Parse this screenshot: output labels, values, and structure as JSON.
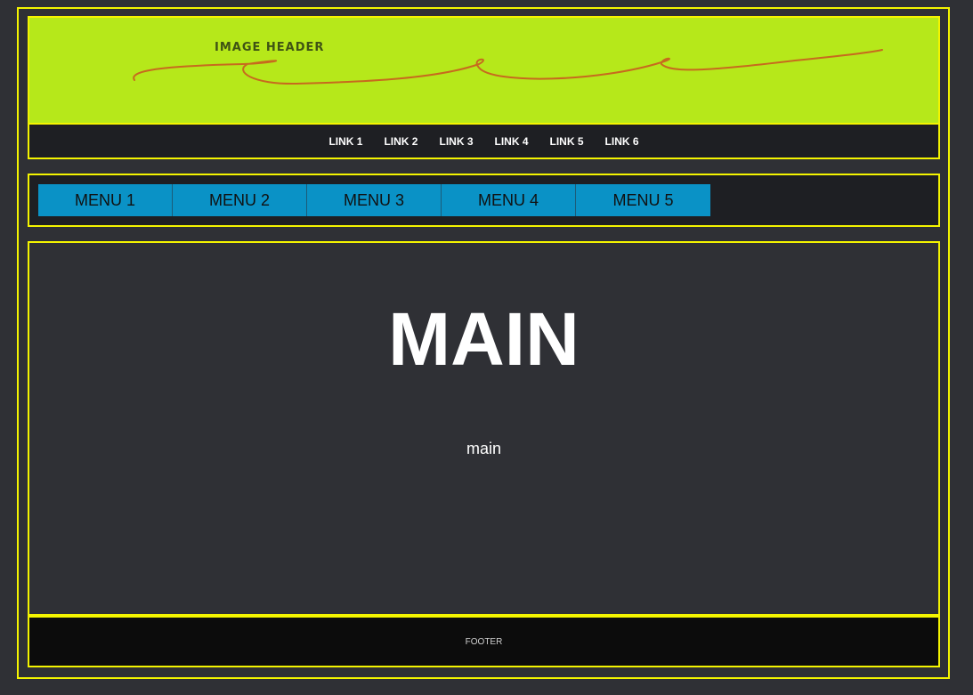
{
  "colors": {
    "background": "#2f3035",
    "border": "#f4f400",
    "header_image": "#b6e81a",
    "nav_background": "#1e1f23",
    "menu_item": "#0a92c6",
    "footer_background": "#0c0c0c"
  },
  "header": {
    "image_label": "IMAGE HEADER"
  },
  "top_nav": {
    "links": [
      "LINK 1",
      "LINK 2",
      "LINK 3",
      "LINK 4",
      "LINK 5",
      "LINK 6"
    ]
  },
  "menu": {
    "items": [
      "MENU 1",
      "MENU 2",
      "MENU 3",
      "MENU 4",
      "MENU 5"
    ]
  },
  "main": {
    "title": "MAIN",
    "text": "main"
  },
  "footer": {
    "text": "FOOTER"
  }
}
